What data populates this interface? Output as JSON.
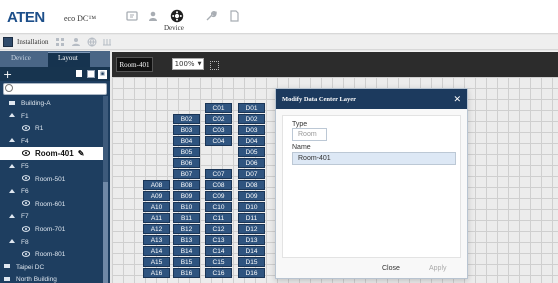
{
  "brand": {
    "logo": "ATEN",
    "product": "eco DC™"
  },
  "top_nav": {
    "active_label": "Device"
  },
  "installation": {
    "label": "Installation"
  },
  "sidebar": {
    "tabs": [
      {
        "label": "Device",
        "active": false
      },
      {
        "label": "Layout",
        "active": true
      }
    ],
    "tree": [
      {
        "text": "Building-A",
        "level": 2,
        "icon": "building-icon"
      },
      {
        "text": "F1",
        "level": 2,
        "icon": "floor-icon"
      },
      {
        "text": "R1",
        "level": 3,
        "icon": "eye-icon"
      },
      {
        "text": "F4",
        "level": 2,
        "icon": "floor-icon"
      },
      {
        "text": "Room-401",
        "level": 3,
        "icon": "eye-icon",
        "selected": true
      },
      {
        "text": "F5",
        "level": 2,
        "icon": "floor-icon"
      },
      {
        "text": "Room-501",
        "level": 3,
        "icon": "eye-icon"
      },
      {
        "text": "F6",
        "level": 2,
        "icon": "floor-icon"
      },
      {
        "text": "Room-601",
        "level": 3,
        "icon": "eye-icon"
      },
      {
        "text": "F7",
        "level": 2,
        "icon": "floor-icon"
      },
      {
        "text": "Room-701",
        "level": 3,
        "icon": "eye-icon"
      },
      {
        "text": "F8",
        "level": 2,
        "icon": "floor-icon"
      },
      {
        "text": "Room-801",
        "level": 3,
        "icon": "eye-icon"
      },
      {
        "text": "Taipei DC",
        "level": 1,
        "icon": "datacenter-icon"
      },
      {
        "text": "North Building",
        "level": 1,
        "icon": "building-icon"
      }
    ]
  },
  "room_tab": {
    "label": "Room-401"
  },
  "zoom": {
    "value": "100%"
  },
  "racks": {
    "A": [
      "A08",
      "A09",
      "A10",
      "A11",
      "A12",
      "A13",
      "A14",
      "A15",
      "A16"
    ],
    "B": [
      "B02",
      "B03",
      "B04",
      "B05",
      "B06",
      "B07",
      "B08",
      "B09",
      "B10",
      "B11",
      "B12",
      "B13",
      "B14",
      "B15",
      "B16"
    ],
    "C": [
      "C01",
      "C02",
      "C03",
      "C04",
      "C07",
      "C08",
      "C09",
      "C10",
      "C11",
      "C12",
      "C13",
      "C14",
      "C15",
      "C16"
    ],
    "D": [
      "D01",
      "D02",
      "D03",
      "D04",
      "D05",
      "D06",
      "D07",
      "D08",
      "D09",
      "D10",
      "D11",
      "D12",
      "D13",
      "D14",
      "D15",
      "D16"
    ]
  },
  "dialog": {
    "title": "Modify Data Center Layer",
    "type_label": "Type",
    "type_value": "Room",
    "name_label": "Name",
    "name_value": "Room-401",
    "close_button": "Close",
    "apply_button": "Apply"
  },
  "colors": {
    "header": "#1c3a5e",
    "sidebar": "#1e3e60",
    "rack": "#2f547f"
  }
}
